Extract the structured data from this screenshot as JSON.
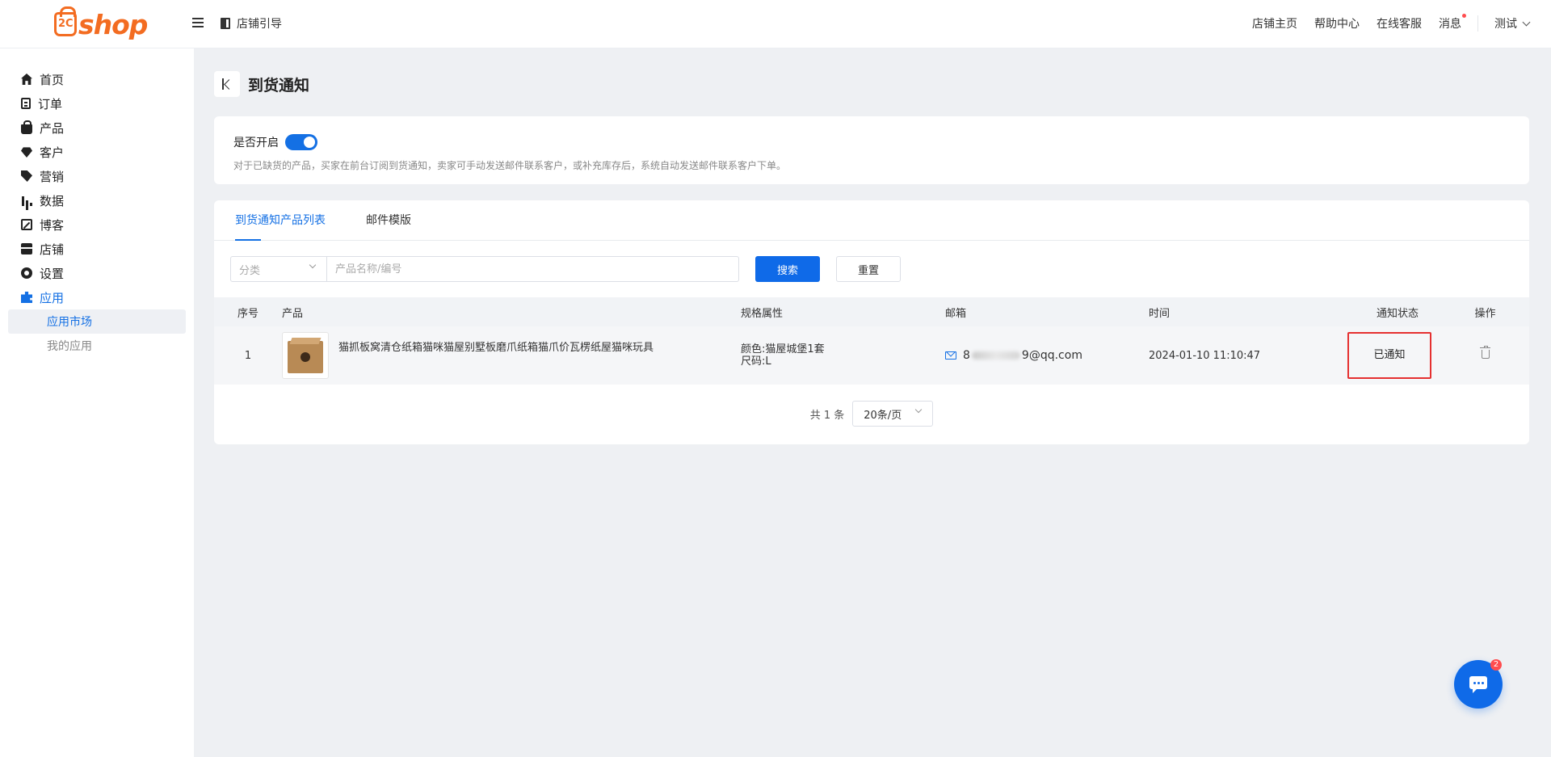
{
  "logo": {
    "mark": "2C",
    "text": "shop"
  },
  "topbar": {
    "guide": "店铺引导",
    "links": [
      "店铺主页",
      "帮助中心",
      "在线客服"
    ],
    "message": "消息",
    "user": "测试"
  },
  "sidebar": {
    "items": [
      {
        "label": "首页",
        "icon": "home-icon"
      },
      {
        "label": "订单",
        "icon": "order-icon"
      },
      {
        "label": "产品",
        "icon": "bag-icon"
      },
      {
        "label": "客户",
        "icon": "gem-icon"
      },
      {
        "label": "营销",
        "icon": "tag-icon"
      },
      {
        "label": "数据",
        "icon": "bar-chart-icon"
      },
      {
        "label": "博客",
        "icon": "edit-icon"
      },
      {
        "label": "店铺",
        "icon": "store-icon"
      },
      {
        "label": "设置",
        "icon": "gear-icon"
      },
      {
        "label": "应用",
        "icon": "puzzle-icon"
      }
    ],
    "sub_items": [
      "应用市场",
      "我的应用"
    ]
  },
  "page": {
    "title": "到货通知",
    "switch_label": "是否开启",
    "switch_on": true,
    "description": "对于已缺货的产品，买家在前台订阅到货通知，卖家可手动发送邮件联系客户，或补充库存后，系统自动发送邮件联系客户下单。"
  },
  "tabs": [
    "到货通知产品列表",
    "邮件模版"
  ],
  "filter": {
    "category_placeholder": "分类",
    "search_placeholder": "产品名称/编号",
    "search_button": "搜索",
    "reset_button": "重置"
  },
  "table": {
    "headers": [
      "序号",
      "产品",
      "规格属性",
      "邮箱",
      "时间",
      "通知状态",
      "操作"
    ],
    "rows": [
      {
        "no": "1",
        "product": "猫抓板窝清仓纸箱猫咪猫屋别墅板磨爪纸箱猫爪价瓦楞纸屋猫咪玩具",
        "spec_color": "颜色:猫屋城堡1套",
        "spec_size": "尺码:L",
        "email_prefix": "8",
        "email_suffix": "9@qq.com",
        "time": "2024-01-10 11:10:47",
        "status": "已通知"
      }
    ]
  },
  "pager": {
    "total": "共 1 条",
    "page_size": "20条/页"
  },
  "chat": {
    "badge": "2"
  },
  "colors": {
    "accent": "#0f6ae8",
    "brand": "#f36c21",
    "highlight": "#e53030"
  }
}
